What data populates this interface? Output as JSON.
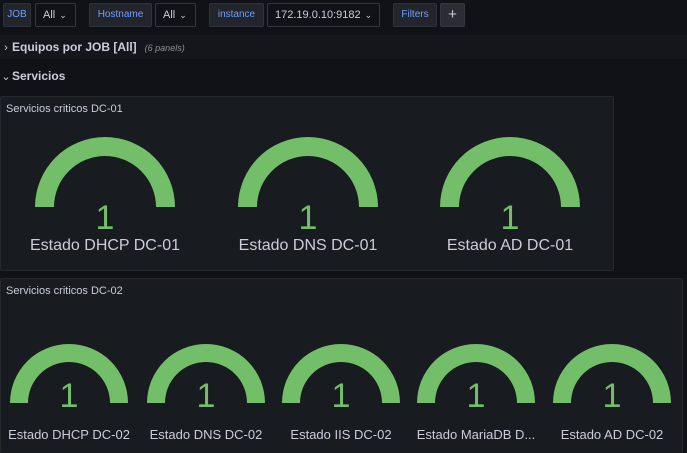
{
  "variables": {
    "job": {
      "label": "JOB",
      "value": "All"
    },
    "hostname": {
      "label": "Hostname",
      "value": "All"
    },
    "instance": {
      "label": "instance",
      "value": "172.19.0.10:9182"
    },
    "filters": {
      "label": "Filters"
    },
    "add_label": "+"
  },
  "rows": {
    "equipos": {
      "title": "Equipos por JOB [All]",
      "meta": "(6 panels)",
      "caret": "›"
    },
    "servicios": {
      "title": "Servicios",
      "caret": "⌄"
    }
  },
  "panels": {
    "dc01": {
      "title": "Servicios criticos DC-01",
      "gauges": [
        {
          "label": "Estado DHCP DC-01",
          "value": "1"
        },
        {
          "label": "Estado DNS DC-01",
          "value": "1"
        },
        {
          "label": "Estado AD DC-01",
          "value": "1"
        }
      ]
    },
    "dc02": {
      "title": "Servicios criticos DC-02",
      "gauges": [
        {
          "label": "Estado DHCP DC-02",
          "value": "1"
        },
        {
          "label": "Estado DNS DC-02",
          "value": "1"
        },
        {
          "label": "Estado IIS DC-02",
          "value": "1"
        },
        {
          "label": "Estado MariaDB D...",
          "value": "1"
        },
        {
          "label": "Estado AD DC-02",
          "value": "1"
        }
      ]
    }
  },
  "colors": {
    "gauge_fill": "#73bf69",
    "accent_blue": "#6e9fff"
  }
}
